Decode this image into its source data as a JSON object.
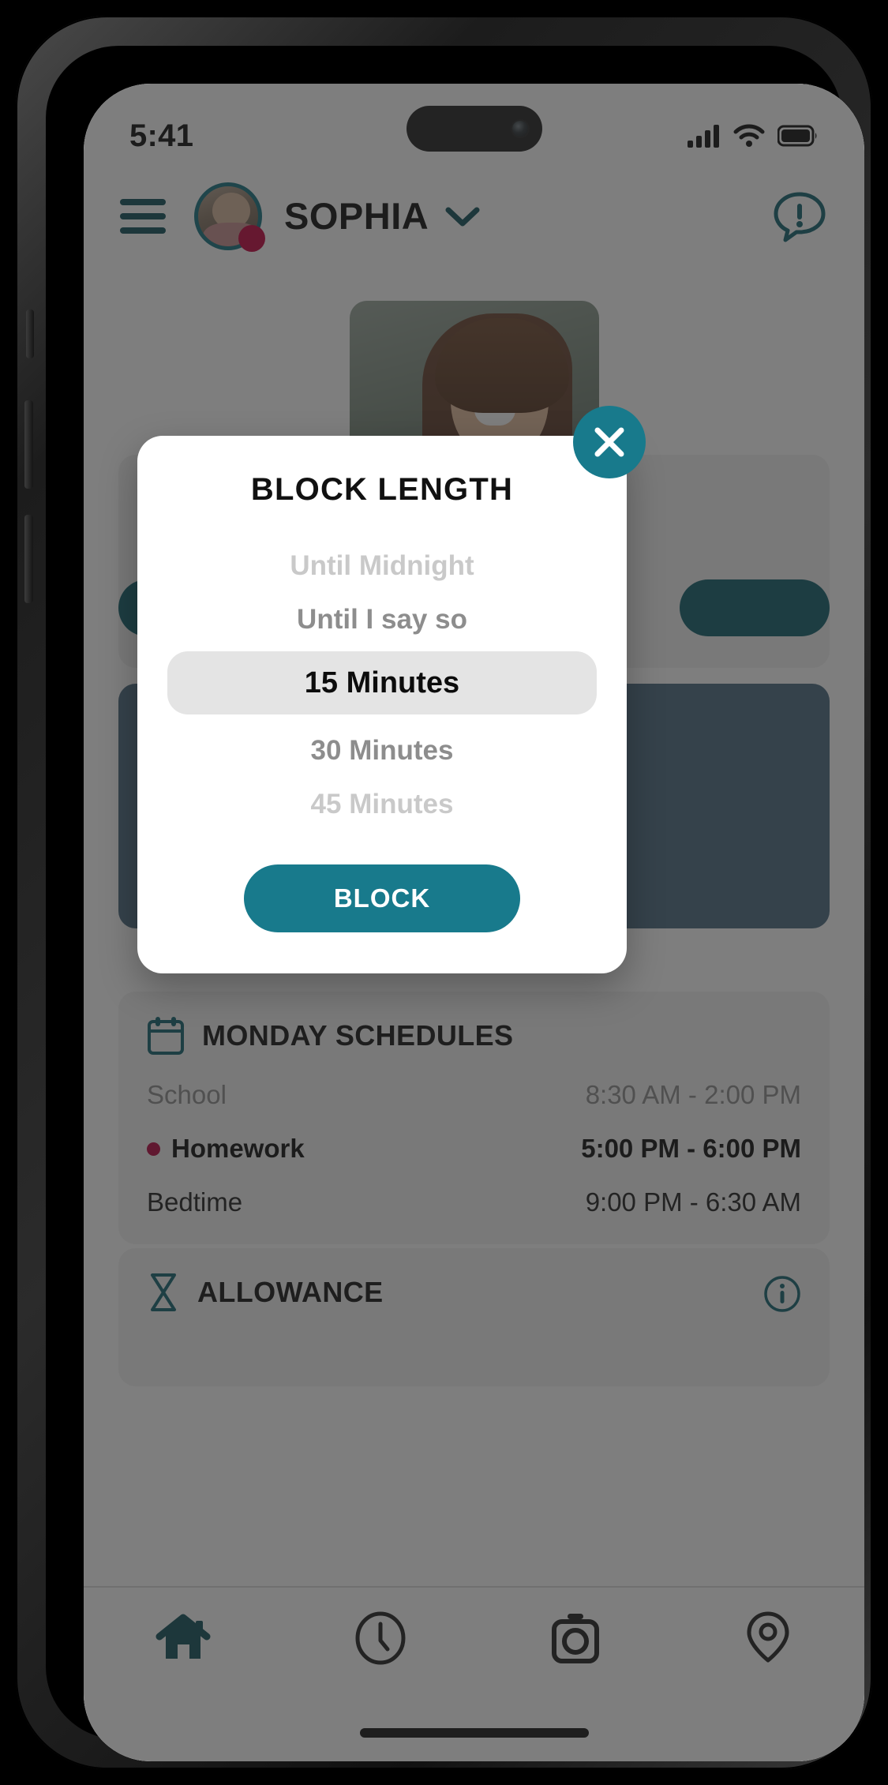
{
  "status_bar": {
    "time": "5:41",
    "icons": [
      "cellular-signal-icon",
      "wifi-icon",
      "battery-icon"
    ]
  },
  "header": {
    "menu_icon": "hamburger-menu-icon",
    "avatar_icon": "user-avatar",
    "profile_name": "SOPHIA",
    "chevron_icon": "chevron-down-icon",
    "alert_icon": "alert-chat-icon"
  },
  "modal": {
    "title": "BLOCK LENGTH",
    "close_icon": "close-x-icon",
    "options": [
      {
        "label": "Until Midnight",
        "state": "far"
      },
      {
        "label": "Until I say so",
        "state": "near"
      },
      {
        "label": "15 Minutes",
        "state": "selected"
      },
      {
        "label": "30 Minutes",
        "state": "near"
      },
      {
        "label": "45 Minutes",
        "state": "far"
      }
    ],
    "selected_value": "15 Minutes",
    "confirm_label": "BLOCK",
    "accent_color": "#187a8c",
    "selected_bg": "#e4e4e4"
  },
  "schedules": {
    "icon": "calendar-icon",
    "title": "MONDAY SCHEDULES",
    "rows": [
      {
        "name": "School",
        "time": "8:30 AM - 2:00 PM",
        "state": "muted",
        "marker": false
      },
      {
        "name": "Homework",
        "time": "5:00 PM - 6:00 PM",
        "state": "active",
        "marker": true
      },
      {
        "name": "Bedtime",
        "time": "9:00 PM - 6:30 AM",
        "state": "normal",
        "marker": false
      }
    ],
    "marker_color": "#b5003c"
  },
  "allowance": {
    "icon": "hourglass-icon",
    "title": "ALLOWANCE",
    "info_icon": "info-icon"
  },
  "bottom_nav": {
    "items": [
      {
        "icon": "home-icon",
        "active": true
      },
      {
        "icon": "clock-icon",
        "active": false
      },
      {
        "icon": "camera-icon",
        "active": false
      },
      {
        "icon": "location-pin-icon",
        "active": false
      }
    ],
    "active_color": "#0e4f57"
  }
}
